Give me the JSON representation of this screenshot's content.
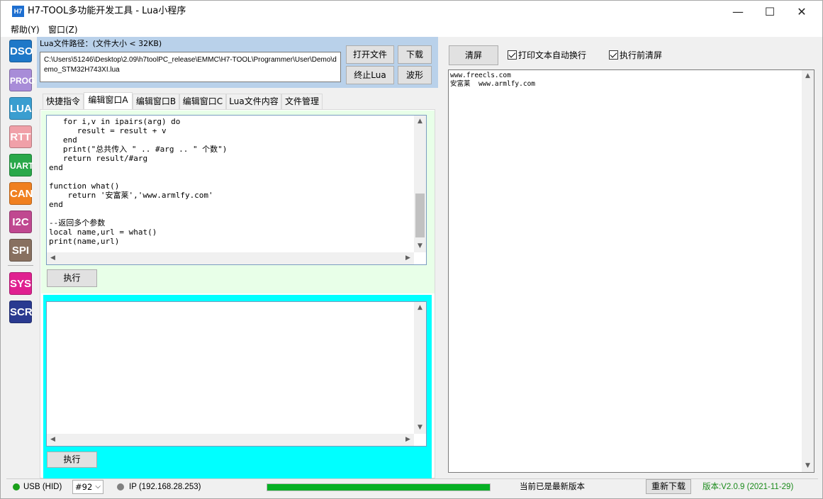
{
  "window": {
    "icon_text": "H7",
    "title": "H7-TOOL多功能开发工具 - Lua小程序",
    "minimize": "—",
    "maximize": "☐",
    "close": "✕"
  },
  "menu": {
    "items": [
      "帮助(Y)",
      "窗口(Z)"
    ]
  },
  "sidebar": {
    "items": [
      {
        "label": "DSO",
        "color": "#1e78c8"
      },
      {
        "label": "PROG",
        "color": "#a88cd8"
      },
      {
        "label": "LUA",
        "color": "#3a9ed0"
      },
      {
        "label": "RTT",
        "color": "#f0a0a8"
      },
      {
        "label": "UART",
        "color": "#2aa84a"
      },
      {
        "label": "CAN",
        "color": "#f08020"
      },
      {
        "label": "I2C",
        "color": "#c04890"
      },
      {
        "label": "SPI",
        "color": "#887060"
      },
      {
        "label": "SYS",
        "color": "#e02090"
      },
      {
        "label": "SCR",
        "color": "#2a3a90"
      }
    ]
  },
  "lua_file": {
    "path_label": "Lua文件路径：(文件大小 < 32KB)",
    "path_value": "C:\\Users\\51246\\Desktop\\2.09\\h7toolPC_release\\EMMC\\H7-TOOL\\Programmer\\User\\Demo\\demo_STM32H743XI.lua",
    "open_button": "打开文件",
    "download_button": "下载",
    "stop_button": "终止Lua",
    "wave_button": "波形"
  },
  "tabs": {
    "items": [
      "快捷指令",
      "编辑窗口A",
      "编辑窗口B",
      "编辑窗口C",
      "Lua文件内容",
      "文件管理"
    ],
    "active": "编辑窗口A"
  },
  "editor": {
    "code": "   for i,v in ipairs(arg) do\n      result = result + v\n   end\n   print(\"总共传入 \" .. #arg .. \" 个数\")\n   return result/#arg\nend\n\nfunction what()\n    return '安富莱','www.armlfy.com'\nend\n\n--返回多个参数\nlocal name,url = what()\nprint(name,url)",
    "execute_button": "执行",
    "input_text": "",
    "execute_button_2": "执行"
  },
  "output": {
    "clear_button": "清屏",
    "auto_wrap_label": "打印文本自动换行",
    "auto_wrap_checked": true,
    "clear_before_exec_label": "执行前清屏",
    "clear_before_exec_checked": true,
    "text": "www.freecls.com\n安富莱  www.armlfy.com"
  },
  "status": {
    "usb_label": "USB (HID)",
    "usb_color": "#1aa01a",
    "port_value": "#92",
    "ip_label": "IP (192.168.28.253)",
    "ip_color": "#808080",
    "progress_percent": 100,
    "progress_color": "#06b025",
    "update_text": "当前已是最新版本",
    "redownload_button": "重新下载",
    "version_text": "版本:V2.0.9 (2021-11-29)",
    "version_color": "#1a8a1a"
  }
}
